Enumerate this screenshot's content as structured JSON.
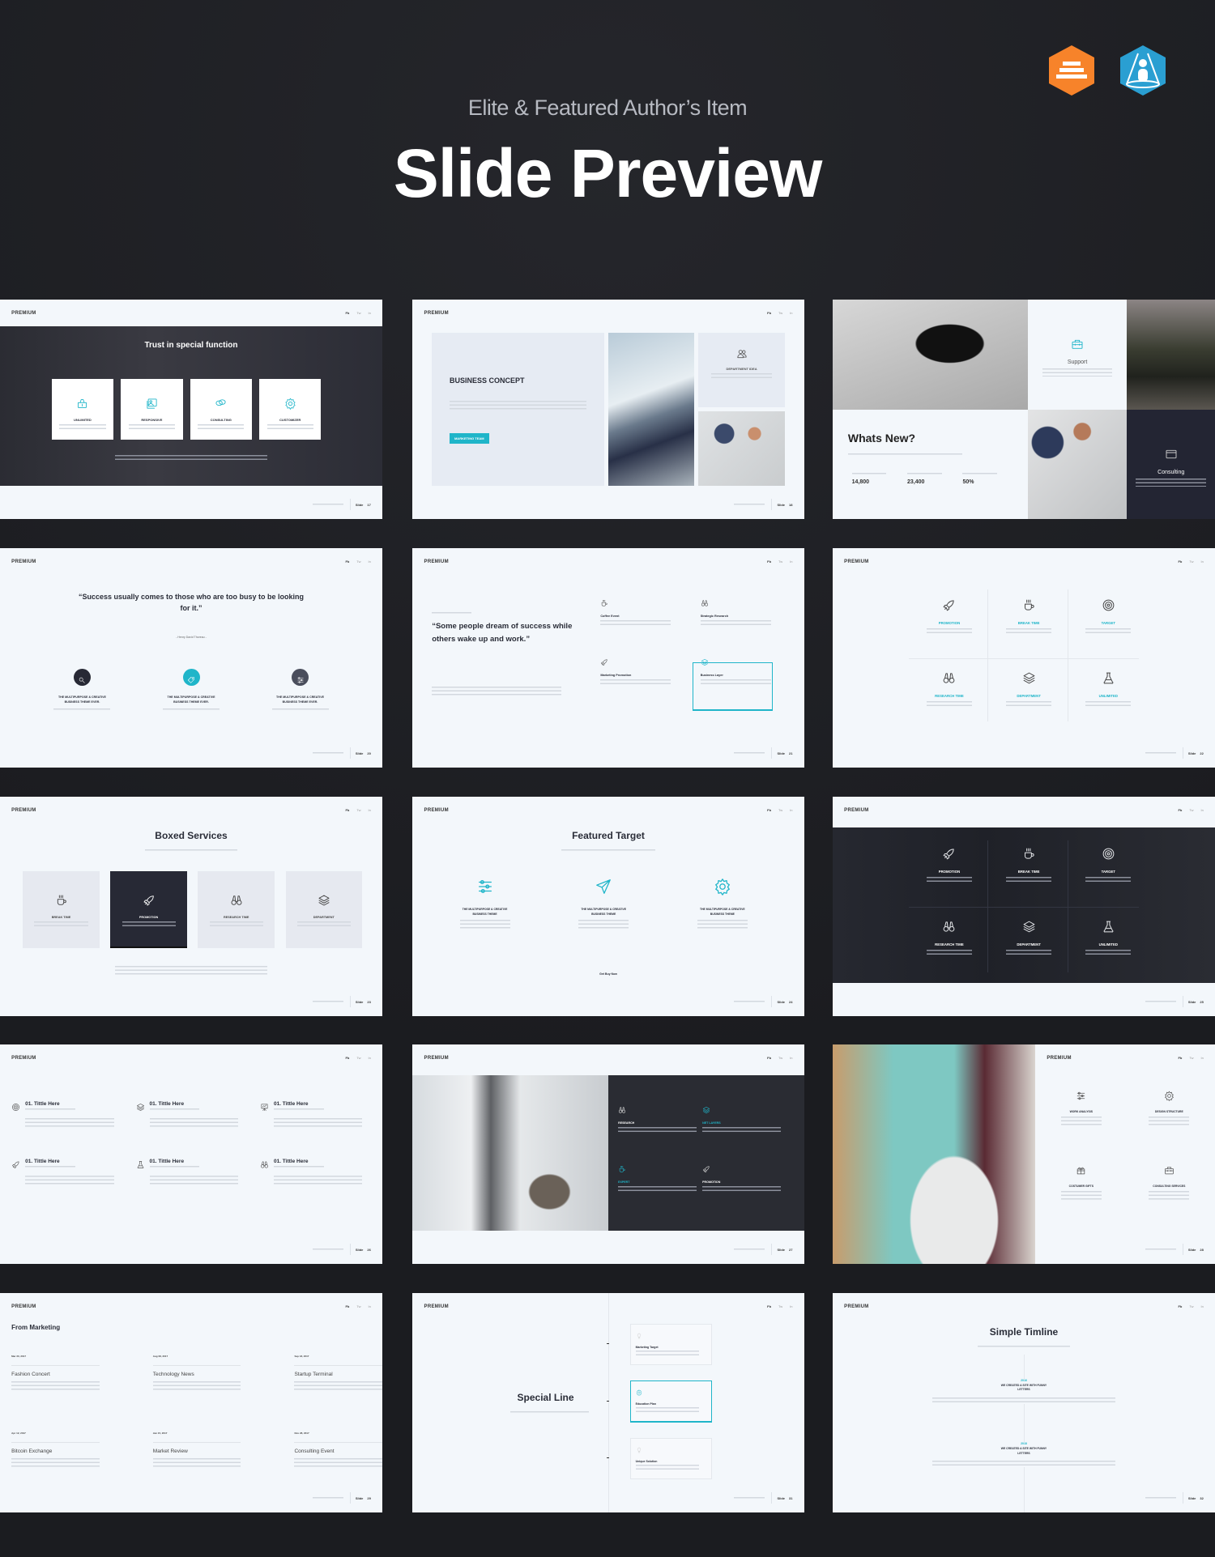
{
  "header": {
    "subtitle": "Elite & Featured Author’s Item",
    "title": "Slide Preview"
  },
  "badges": [
    {
      "icon": "elite-author-badge",
      "color": "#f7832a"
    },
    {
      "icon": "featured-author-badge",
      "color": "#2a9fd2"
    }
  ],
  "colors": {
    "accent": "#1fb5c9",
    "dark": "#272935",
    "slide_bg": "#f3f7fb",
    "page_bg": "#1c1d21"
  },
  "common": {
    "brand": "PREMIUM",
    "nav": [
      "Fb",
      "Tw",
      "In"
    ],
    "slide_label": "Slide"
  },
  "slides": {
    "s17": {
      "number": "17",
      "title": "Trust in special function",
      "cards": [
        {
          "icon": "basket-icon",
          "label": "UNLIMITED"
        },
        {
          "icon": "image-icon",
          "label": "RESPONSIVE"
        },
        {
          "icon": "chat-icon",
          "label": "CONSULTING"
        },
        {
          "icon": "gear-icon",
          "label": "CUSTOMIZER"
        }
      ]
    },
    "s18": {
      "number": "18",
      "title": "BUSINESS CONCEPT",
      "button": "MARKETING TEAM",
      "box_label": "DEPARTMENT IDEA"
    },
    "s19": {
      "title": "Whats New?",
      "support": "Support",
      "consulting": "Consulting",
      "stats": [
        {
          "value": "14,800"
        },
        {
          "value": "23,400"
        },
        {
          "value": "50%"
        }
      ]
    },
    "s20": {
      "number": "20",
      "quote": "“Success usually comes to those who are too busy to be looking for it.”",
      "author": "- Henry David Thoreau -",
      "items": [
        {
          "icon": "search-icon",
          "color": "#272935",
          "caption": "THE MULTIPURPOSE & CREATIVE BUSINESS THEME EVER."
        },
        {
          "icon": "tag-icon",
          "color": "#1fb5c9",
          "caption": "THE MULTIPURPOSE & CREATIVE BUSINESS THEME EVER."
        },
        {
          "icon": "sliders-icon",
          "color": "#4a4e5c",
          "caption": "THE MULTIPURPOSE & CREATIVE BUSINESS THEME EVER."
        }
      ]
    },
    "s21": {
      "number": "21",
      "quote": "“Some people dream of success while others wake up and work.”",
      "items": [
        {
          "icon": "cup-icon",
          "label": "Coffee Event"
        },
        {
          "icon": "binoculars-icon",
          "label": "Strategic Research"
        },
        {
          "icon": "rocket-icon",
          "label": "Marketing Promotion"
        },
        {
          "icon": "layers-icon",
          "label": "Business Layer"
        }
      ]
    },
    "s22": {
      "number": "22",
      "items": [
        {
          "icon": "rocket-icon",
          "label": "PROMOTION"
        },
        {
          "icon": "cup-icon",
          "label": "BREAK TIME"
        },
        {
          "icon": "target-icon",
          "label": "TARGET"
        },
        {
          "icon": "binoculars-icon",
          "label": "RESEARCH TIME"
        },
        {
          "icon": "layers-icon",
          "label": "DEPARTMENT"
        },
        {
          "icon": "flask-icon",
          "label": "UNLIMITED"
        }
      ]
    },
    "s23": {
      "number": "23",
      "title": "Boxed Services",
      "boxes": [
        {
          "icon": "cup-icon",
          "label": "BREAK TIME"
        },
        {
          "icon": "rocket-icon",
          "label": "PROMOTION"
        },
        {
          "icon": "binoculars-icon",
          "label": "RESEARCH TIME"
        },
        {
          "icon": "layers-icon",
          "label": "DEPARTMENT"
        }
      ]
    },
    "s24": {
      "number": "24",
      "title": "Featured Target",
      "link": "Get Buy Now",
      "items": [
        {
          "icon": "sliders-icon",
          "caption": "THE MULTIPURPOSE & CREATIVE BUSINESS THEME"
        },
        {
          "icon": "plane-icon",
          "caption": "THE MULTIPURPOSE & CREATIVE BUSINESS THEME"
        },
        {
          "icon": "gear-icon",
          "caption": "THE MULTIPURPOSE & CREATIVE BUSINESS THEME"
        }
      ]
    },
    "s25": {
      "number": "25",
      "items": [
        {
          "icon": "rocket-icon",
          "label": "PROMOTION"
        },
        {
          "icon": "cup-icon",
          "label": "BREAK TIME"
        },
        {
          "icon": "target-icon",
          "label": "TARGET"
        },
        {
          "icon": "binoculars-icon",
          "label": "RESEARCH TIME"
        },
        {
          "icon": "layers-icon",
          "label": "DEPARTMENT"
        },
        {
          "icon": "flask-icon",
          "label": "UNLIMITED"
        }
      ]
    },
    "s26": {
      "number": "26",
      "items": [
        {
          "icon": "target-icon",
          "title": "01. Tittle Here"
        },
        {
          "icon": "layers-icon",
          "title": "01. Tittle Here"
        },
        {
          "icon": "board-icon",
          "title": "01. Tittle Here"
        },
        {
          "icon": "rocket-icon",
          "title": "01. Tittle Here"
        },
        {
          "icon": "flask-icon",
          "title": "01. Tittle Here"
        },
        {
          "icon": "binoculars-icon",
          "title": "01. Tittle Here"
        }
      ]
    },
    "s27": {
      "number": "27",
      "items": [
        {
          "icon": "binoculars-icon",
          "label": "RESEARCH",
          "accent": false
        },
        {
          "icon": "layers-icon",
          "label": "NET LAYERS",
          "accent": true
        },
        {
          "icon": "cup-icon",
          "label": "EXPERT",
          "accent": true
        },
        {
          "icon": "rocket-icon",
          "label": "PROMOTION",
          "accent": false
        }
      ]
    },
    "s28": {
      "number": "28",
      "items": [
        {
          "icon": "sliders-icon",
          "label": "WORK ANALYSIS"
        },
        {
          "icon": "gear-icon",
          "label": "DESIGN STRUCTURE"
        },
        {
          "icon": "gift-icon",
          "label": "COSTUMER GIFTS"
        },
        {
          "icon": "briefcase-icon",
          "label": "CONSULTING SERVICES"
        }
      ]
    },
    "s29": {
      "number": "29",
      "title": "From Marketing",
      "posts": [
        {
          "date": "Mar 20, 2017",
          "title": "Fashion Concert"
        },
        {
          "date": "Aug 08, 2017",
          "title": "Technology News"
        },
        {
          "date": "Sep 18, 2017",
          "title": "Startup Terminal"
        },
        {
          "date": "Apr 12, 2017",
          "title": "Bitcoin Exchange"
        },
        {
          "date": "Jan 15, 2017",
          "title": "Market Review"
        },
        {
          "date": "Nov 28, 2017",
          "title": "Consulting Event"
        }
      ]
    },
    "s30": {
      "number": "31",
      "title": "Special Line",
      "cards": [
        {
          "icon": "bulb-icon",
          "label": "Marketing Target",
          "active": false
        },
        {
          "icon": "gear-icon",
          "label": "Education Plan",
          "active": true
        },
        {
          "icon": "bulb-icon",
          "label": "Unique Solution",
          "active": false
        }
      ]
    },
    "s31": {
      "number": "32",
      "title": "Simple Timline",
      "events": [
        {
          "year": "2016",
          "caption": "WE CREATED A SITE WITH FUNNY LETTERS"
        },
        {
          "year": "2018",
          "caption": "WE CREATED A SITE WITH FUNNY LETTERS"
        }
      ]
    }
  }
}
